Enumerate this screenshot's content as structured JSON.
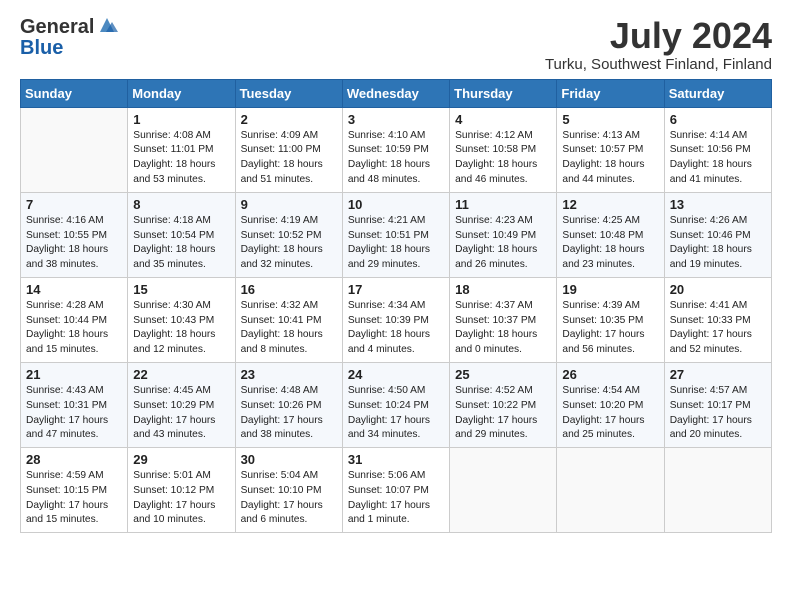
{
  "header": {
    "logo_general": "General",
    "logo_blue": "Blue",
    "month_title": "July 2024",
    "location": "Turku, Southwest Finland, Finland"
  },
  "days_of_week": [
    "Sunday",
    "Monday",
    "Tuesday",
    "Wednesday",
    "Thursday",
    "Friday",
    "Saturday"
  ],
  "weeks": [
    [
      {
        "day": "",
        "content": ""
      },
      {
        "day": "1",
        "content": "Sunrise: 4:08 AM\nSunset: 11:01 PM\nDaylight: 18 hours\nand 53 minutes."
      },
      {
        "day": "2",
        "content": "Sunrise: 4:09 AM\nSunset: 11:00 PM\nDaylight: 18 hours\nand 51 minutes."
      },
      {
        "day": "3",
        "content": "Sunrise: 4:10 AM\nSunset: 10:59 PM\nDaylight: 18 hours\nand 48 minutes."
      },
      {
        "day": "4",
        "content": "Sunrise: 4:12 AM\nSunset: 10:58 PM\nDaylight: 18 hours\nand 46 minutes."
      },
      {
        "day": "5",
        "content": "Sunrise: 4:13 AM\nSunset: 10:57 PM\nDaylight: 18 hours\nand 44 minutes."
      },
      {
        "day": "6",
        "content": "Sunrise: 4:14 AM\nSunset: 10:56 PM\nDaylight: 18 hours\nand 41 minutes."
      }
    ],
    [
      {
        "day": "7",
        "content": "Sunrise: 4:16 AM\nSunset: 10:55 PM\nDaylight: 18 hours\nand 38 minutes."
      },
      {
        "day": "8",
        "content": "Sunrise: 4:18 AM\nSunset: 10:54 PM\nDaylight: 18 hours\nand 35 minutes."
      },
      {
        "day": "9",
        "content": "Sunrise: 4:19 AM\nSunset: 10:52 PM\nDaylight: 18 hours\nand 32 minutes."
      },
      {
        "day": "10",
        "content": "Sunrise: 4:21 AM\nSunset: 10:51 PM\nDaylight: 18 hours\nand 29 minutes."
      },
      {
        "day": "11",
        "content": "Sunrise: 4:23 AM\nSunset: 10:49 PM\nDaylight: 18 hours\nand 26 minutes."
      },
      {
        "day": "12",
        "content": "Sunrise: 4:25 AM\nSunset: 10:48 PM\nDaylight: 18 hours\nand 23 minutes."
      },
      {
        "day": "13",
        "content": "Sunrise: 4:26 AM\nSunset: 10:46 PM\nDaylight: 18 hours\nand 19 minutes."
      }
    ],
    [
      {
        "day": "14",
        "content": "Sunrise: 4:28 AM\nSunset: 10:44 PM\nDaylight: 18 hours\nand 15 minutes."
      },
      {
        "day": "15",
        "content": "Sunrise: 4:30 AM\nSunset: 10:43 PM\nDaylight: 18 hours\nand 12 minutes."
      },
      {
        "day": "16",
        "content": "Sunrise: 4:32 AM\nSunset: 10:41 PM\nDaylight: 18 hours\nand 8 minutes."
      },
      {
        "day": "17",
        "content": "Sunrise: 4:34 AM\nSunset: 10:39 PM\nDaylight: 18 hours\nand 4 minutes."
      },
      {
        "day": "18",
        "content": "Sunrise: 4:37 AM\nSunset: 10:37 PM\nDaylight: 18 hours\nand 0 minutes."
      },
      {
        "day": "19",
        "content": "Sunrise: 4:39 AM\nSunset: 10:35 PM\nDaylight: 17 hours\nand 56 minutes."
      },
      {
        "day": "20",
        "content": "Sunrise: 4:41 AM\nSunset: 10:33 PM\nDaylight: 17 hours\nand 52 minutes."
      }
    ],
    [
      {
        "day": "21",
        "content": "Sunrise: 4:43 AM\nSunset: 10:31 PM\nDaylight: 17 hours\nand 47 minutes."
      },
      {
        "day": "22",
        "content": "Sunrise: 4:45 AM\nSunset: 10:29 PM\nDaylight: 17 hours\nand 43 minutes."
      },
      {
        "day": "23",
        "content": "Sunrise: 4:48 AM\nSunset: 10:26 PM\nDaylight: 17 hours\nand 38 minutes."
      },
      {
        "day": "24",
        "content": "Sunrise: 4:50 AM\nSunset: 10:24 PM\nDaylight: 17 hours\nand 34 minutes."
      },
      {
        "day": "25",
        "content": "Sunrise: 4:52 AM\nSunset: 10:22 PM\nDaylight: 17 hours\nand 29 minutes."
      },
      {
        "day": "26",
        "content": "Sunrise: 4:54 AM\nSunset: 10:20 PM\nDaylight: 17 hours\nand 25 minutes."
      },
      {
        "day": "27",
        "content": "Sunrise: 4:57 AM\nSunset: 10:17 PM\nDaylight: 17 hours\nand 20 minutes."
      }
    ],
    [
      {
        "day": "28",
        "content": "Sunrise: 4:59 AM\nSunset: 10:15 PM\nDaylight: 17 hours\nand 15 minutes."
      },
      {
        "day": "29",
        "content": "Sunrise: 5:01 AM\nSunset: 10:12 PM\nDaylight: 17 hours\nand 10 minutes."
      },
      {
        "day": "30",
        "content": "Sunrise: 5:04 AM\nSunset: 10:10 PM\nDaylight: 17 hours\nand 6 minutes."
      },
      {
        "day": "31",
        "content": "Sunrise: 5:06 AM\nSunset: 10:07 PM\nDaylight: 17 hours\nand 1 minute."
      },
      {
        "day": "",
        "content": ""
      },
      {
        "day": "",
        "content": ""
      },
      {
        "day": "",
        "content": ""
      }
    ]
  ]
}
